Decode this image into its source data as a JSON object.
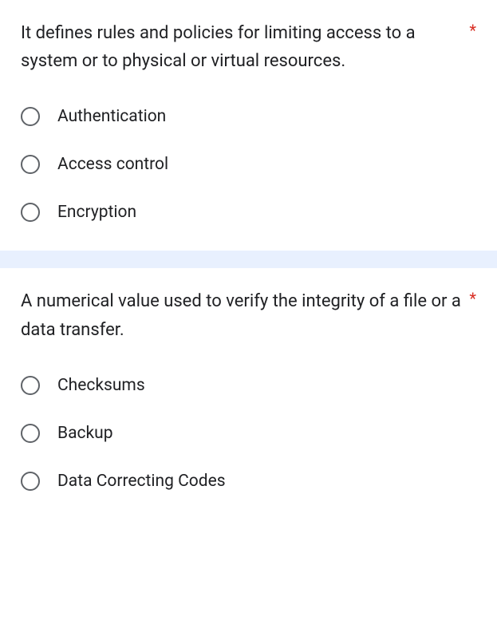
{
  "required_marker": "*",
  "questions": [
    {
      "prompt": "It defines rules and policies for limiting access to a system or to physical or virtual resources.",
      "options": [
        "Authentication",
        "Access control",
        "Encryption"
      ]
    },
    {
      "prompt": "A numerical value used to verify the integrity of a file or a data transfer.",
      "options": [
        "Checksums",
        "Backup",
        "Data Correcting Codes"
      ]
    }
  ]
}
